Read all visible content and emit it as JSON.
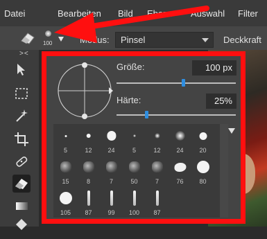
{
  "menu": [
    "Datei",
    "Bearbeiten",
    "Bild",
    "Ebene",
    "Auswahl",
    "Filter"
  ],
  "toolbar": {
    "brush_preset_size": "100",
    "mode_label": "Modus:",
    "mode_value": "Pinsel",
    "opacity_label": "Deckkraft"
  },
  "panel": {
    "size_label": "Größe:",
    "size_value": "100 px",
    "size_fraction": 0.56,
    "hardness_label": "Härte:",
    "hardness_value": "25%",
    "hardness_fraction": 0.25
  },
  "brushes": [
    {
      "kind": "dot",
      "size": "5"
    },
    {
      "kind": "dot",
      "size": "12"
    },
    {
      "kind": "dot",
      "size": "24"
    },
    {
      "kind": "soft",
      "size": "5"
    },
    {
      "kind": "soft",
      "size": "12"
    },
    {
      "kind": "soft",
      "size": "24"
    },
    {
      "kind": "dot",
      "size": "20"
    },
    {
      "kind": "texture",
      "size": "15"
    },
    {
      "kind": "texture",
      "size": "8"
    },
    {
      "kind": "texture",
      "size": "7"
    },
    {
      "kind": "texture",
      "size": "50"
    },
    {
      "kind": "texture",
      "size": "7"
    },
    {
      "kind": "blob",
      "size": "76"
    },
    {
      "kind": "dot",
      "size": "80"
    },
    {
      "kind": "dot",
      "size": "105"
    },
    {
      "kind": "stroke",
      "size": "87"
    },
    {
      "kind": "stroke",
      "size": "99"
    },
    {
      "kind": "stroke",
      "size": "100"
    },
    {
      "kind": "stroke",
      "size": "87"
    }
  ],
  "icons": {
    "brush_preset": "eraser-icon",
    "preset_dropdown": "chevron-down-icon",
    "annotation": "red-arrow-icon",
    "more": "triangle-down-icon",
    "panel_collapse": "collapse-icon"
  },
  "colors": {
    "highlight": "#ff0f0f",
    "slider_accent": "#2f8ee0"
  }
}
